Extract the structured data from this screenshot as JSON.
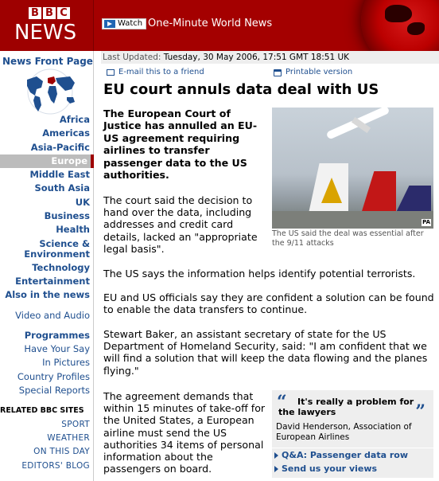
{
  "masthead": {
    "bbc_letters": [
      "B",
      "B",
      "C"
    ],
    "news_word": "NEWS",
    "watch_label": "Watch",
    "channel_title": "One-Minute World News",
    "brand_color": "#a40000"
  },
  "sidebar": {
    "front_page": "News Front Page",
    "nav": [
      {
        "label": "Africa"
      },
      {
        "label": "Americas"
      },
      {
        "label": "Asia-Pacific"
      },
      {
        "label": "Europe",
        "active": true
      },
      {
        "label": "Middle East"
      },
      {
        "label": "South Asia"
      },
      {
        "label": "UK"
      },
      {
        "label": "Business"
      },
      {
        "label": "Health"
      },
      {
        "label": "Science & Environment",
        "line1": "Science &",
        "line2": "Environment"
      },
      {
        "label": "Technology"
      },
      {
        "label": "Entertainment"
      },
      {
        "label": "Also in the news"
      }
    ],
    "media": "Video and Audio",
    "programmes": "Programmes",
    "secondary": [
      "Have Your Say",
      "In Pictures",
      "Country Profiles",
      "Special Reports"
    ],
    "related_heading": "RELATED BBC SITES",
    "related": [
      "SPORT",
      "WEATHER",
      "ON THIS DAY",
      "EDITORS' BLOG"
    ]
  },
  "article": {
    "updated_label": "Last Updated:",
    "updated_value": "Tuesday, 30 May 2006, 17:51 GMT 18:51 UK",
    "email_label": "E-mail this to a friend",
    "print_label": "Printable version",
    "headline": "EU court annuls data deal with US",
    "intro": "The European Court of Justice has annulled an EU-US agreement requiring airlines to transfer passenger data to the US authorities.",
    "para1": "The court said the decision to hand over the data, including addresses and credit card details, lacked an \"appropriate legal basis\".",
    "para2": "The US says the information helps identify potential terrorists.",
    "para3": "EU and US officials say they are confident a solution can be found to enable the data transfers to continue.",
    "para4": "Stewart Baker, an assistant secretary of state for the US Department of Homeland Security, said: \"I am confident that we will find a solution that will keep the data flowing and the planes flying.\"",
    "para5": "The agreement demands that within 15 minutes of take-off for the United States, a European airline must send the US authorities 34 items of personal information about the passengers on board.",
    "photo_credit": "PA",
    "caption": "The US said the deal was essential after the 9/11 attacks",
    "quote": {
      "text": "It's really a problem for the lawyers",
      "author": "David Henderson, Association of European Airlines"
    },
    "links": [
      "Q&A: Passenger data row",
      "Send us your views"
    ]
  }
}
